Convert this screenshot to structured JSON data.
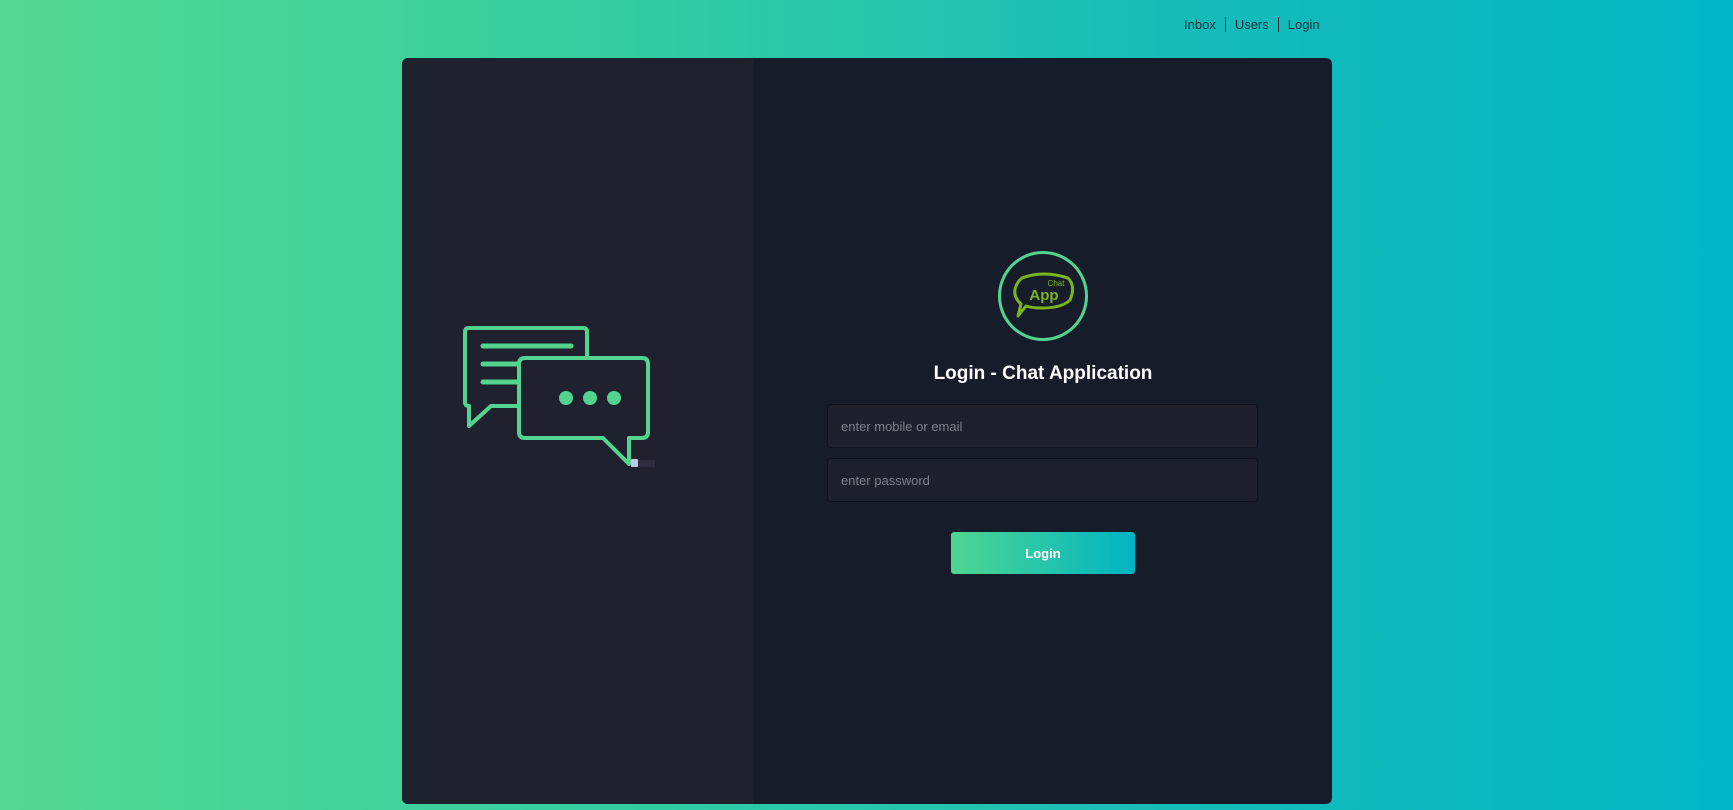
{
  "nav": {
    "items": [
      {
        "label": "Inbox"
      },
      {
        "label": "Users"
      },
      {
        "label": "Login"
      }
    ]
  },
  "logo": {
    "line1": "Chat",
    "line2": "App"
  },
  "login": {
    "title": "Login - Chat Application",
    "username_placeholder": "enter mobile or email",
    "password_placeholder": "enter password",
    "button_label": "Login"
  },
  "colors": {
    "accent": "#52d48f",
    "accent_end": "#00b4c3",
    "card_bg": "#171c2a",
    "panel_bg": "#1f212f",
    "logo_green": "#7bb51e"
  },
  "icons": {
    "illustration": "chat-bubbles-person-illustration",
    "logo": "chat-app-logo-icon"
  }
}
